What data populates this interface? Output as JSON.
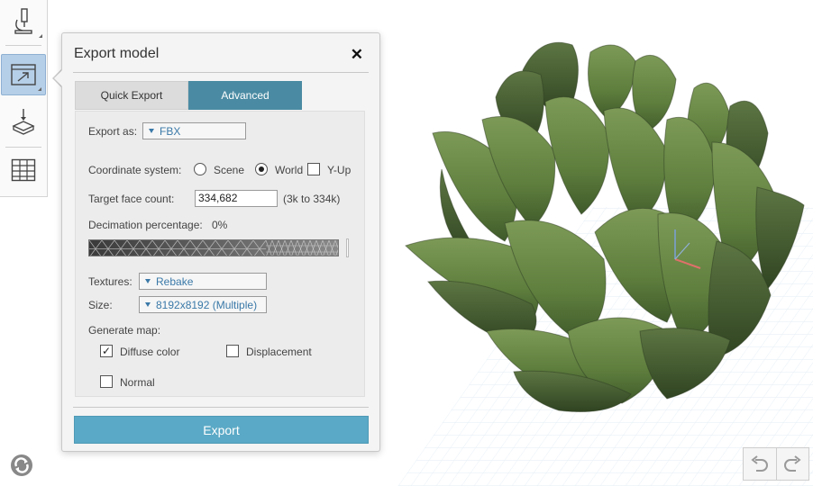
{
  "toolbar": {
    "tools": [
      {
        "icon": "microscope-icon",
        "active": false
      },
      {
        "icon": "export-icon",
        "active": true
      },
      {
        "icon": "print-3d-icon",
        "active": false
      },
      {
        "icon": "table-grid-icon",
        "active": false
      }
    ]
  },
  "dialog": {
    "title": "Export model",
    "close_glyph": "✕",
    "tabs": [
      {
        "label": "Quick Export",
        "active": false
      },
      {
        "label": "Advanced",
        "active": true
      }
    ],
    "export_as": {
      "label": "Export as:",
      "value": "FBX"
    },
    "coordinate_system": {
      "label": "Coordinate system:",
      "options": [
        {
          "label": "Scene",
          "selected": false
        },
        {
          "label": "World",
          "selected": true
        }
      ],
      "y_up": {
        "label": "Y-Up",
        "checked": false
      }
    },
    "target_face_count": {
      "label": "Target face count:",
      "value": "334,682",
      "range": "(3k to 334k)"
    },
    "decimation": {
      "label": "Decimation percentage:",
      "value": "0%",
      "level": 0
    },
    "textures": {
      "label": "Textures:",
      "value": "Rebake"
    },
    "size": {
      "label": "Size:",
      "value": "8192x8192 (Multiple)"
    },
    "generate_map": {
      "label": "Generate map:",
      "maps": [
        {
          "label": "Diffuse color",
          "checked": true
        },
        {
          "label": "Displacement",
          "checked": false
        },
        {
          "label": "Normal",
          "checked": false
        }
      ]
    },
    "export_button": "Export"
  },
  "viewport": {
    "model": "artichoke",
    "gizmo_colors": {
      "x": "#e0706a",
      "y": "#7aa0d8",
      "z": "#8fb0d8"
    }
  },
  "history": {
    "undo_icon": "undo-icon",
    "redo_icon": "redo-icon"
  },
  "sync_icon": "sync-icon"
}
